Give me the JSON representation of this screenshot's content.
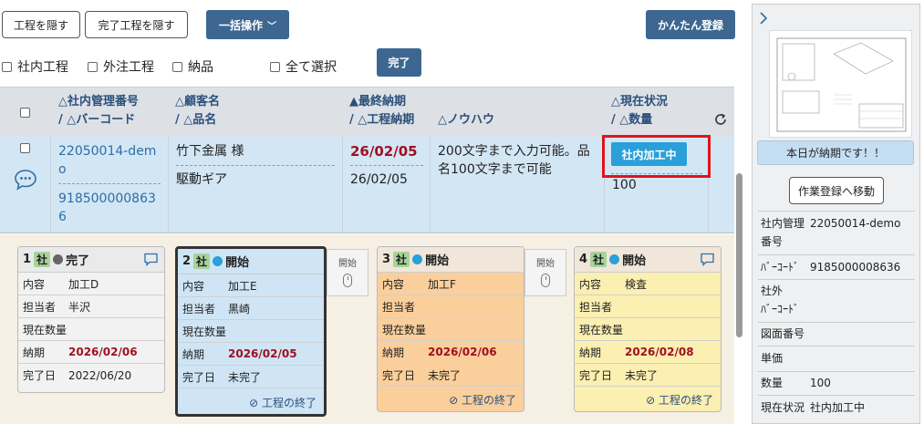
{
  "toolbar": {
    "hide_process": "工程を隠す",
    "hide_done": "完了工程を隠す",
    "bulk": "一括操作",
    "easy_register": "かんたん登録",
    "complete": "完了"
  },
  "filters": {
    "internal": "社内工程",
    "outsourced": "外注工程",
    "delivery": "納品",
    "select_all": "全て選択"
  },
  "header": {
    "c1a": "△社内管理番号",
    "c1b": "/ △バーコード",
    "c2a": "△顧客名",
    "c2b": "/ △品名",
    "c3a": "▲最終納期",
    "c3b": "/ △工程納期",
    "c4": "△ノウハウ",
    "c5a": "△現在状況",
    "c5b": "/ △数量"
  },
  "row": {
    "mgmt_no": "22050014-demo",
    "barcode": "9185000008636",
    "customer": "竹下金属 様",
    "product": "駆動ギア",
    "final_due": "26/02/05",
    "proc_due": "26/02/05",
    "knowhow": "200文字まで入力可能。品名100文字まで可能",
    "status": "社内加工中",
    "qty": "100"
  },
  "cards": [
    {
      "num": "1",
      "tag": "社",
      "state": "完了",
      "dot": "#666666",
      "bg": "#f2f2f2",
      "hbg": "#eaeaea",
      "content_k": "内容",
      "content_v": "加工D",
      "person_k": "担当者",
      "person_v": "半沢",
      "qty_k": "現在数量",
      "due_k": "納期",
      "due_v": "2026/02/06",
      "done_k": "完了日",
      "done_v": "2022/06/20"
    },
    {
      "num": "2",
      "tag": "社",
      "state": "開始",
      "dot": "#2aa0d8",
      "bg": "#cfe5f5",
      "hbg": "#cfe5f5",
      "content_k": "内容",
      "content_v": "加工E",
      "person_k": "担当者",
      "person_v": "黒崎",
      "qty_k": "現在数量",
      "due_k": "納期",
      "due_v": "2026/02/05",
      "done_k": "完了日",
      "done_v": "未完了",
      "finish": "工程の終了"
    },
    {
      "num": "3",
      "tag": "社",
      "state": "開始",
      "dot": "#2aa0d8",
      "bg": "#fbcf9b",
      "hbg": "#f1e6da",
      "content_k": "内容",
      "content_v": "加工F",
      "person_k": "担当者",
      "person_v": "",
      "qty_k": "現在数量",
      "due_k": "納期",
      "due_v": "2026/02/06",
      "done_k": "完了日",
      "done_v": "未完了",
      "finish": "工程の終了"
    },
    {
      "num": "4",
      "tag": "社",
      "state": "開始",
      "dot": "#2aa0d8",
      "bg": "#fbefb1",
      "hbg": "#f1e6da",
      "content_k": "内容",
      "content_v": "検査",
      "person_k": "担当者",
      "person_v": "",
      "qty_k": "現在数量",
      "due_k": "納期",
      "due_v": "2026/02/08",
      "done_k": "完了日",
      "done_v": "未完了",
      "finish": "工程の終了"
    }
  ],
  "start_label": "開始",
  "sidebar": {
    "notice": "本日が納期です！！",
    "move_btn": "作業登録へ移動",
    "mgmt_label": "社内管理番号",
    "mgmt_label_a": "社内管理",
    "mgmt_label_b": "番号",
    "mgmt_val": "22050014-demo",
    "barcode_label": "ﾊﾞｰｺｰﾄﾞ",
    "barcode_val": "9185000008636",
    "ext_label_a": "社外",
    "ext_label_b": "ﾊﾞｰｺｰﾄﾞ",
    "drawing_label": "図面番号",
    "unit_label": "単価",
    "qty_label": "数量",
    "qty_val": "100",
    "status_label": "現在状況",
    "status_val": "社内加工中"
  }
}
